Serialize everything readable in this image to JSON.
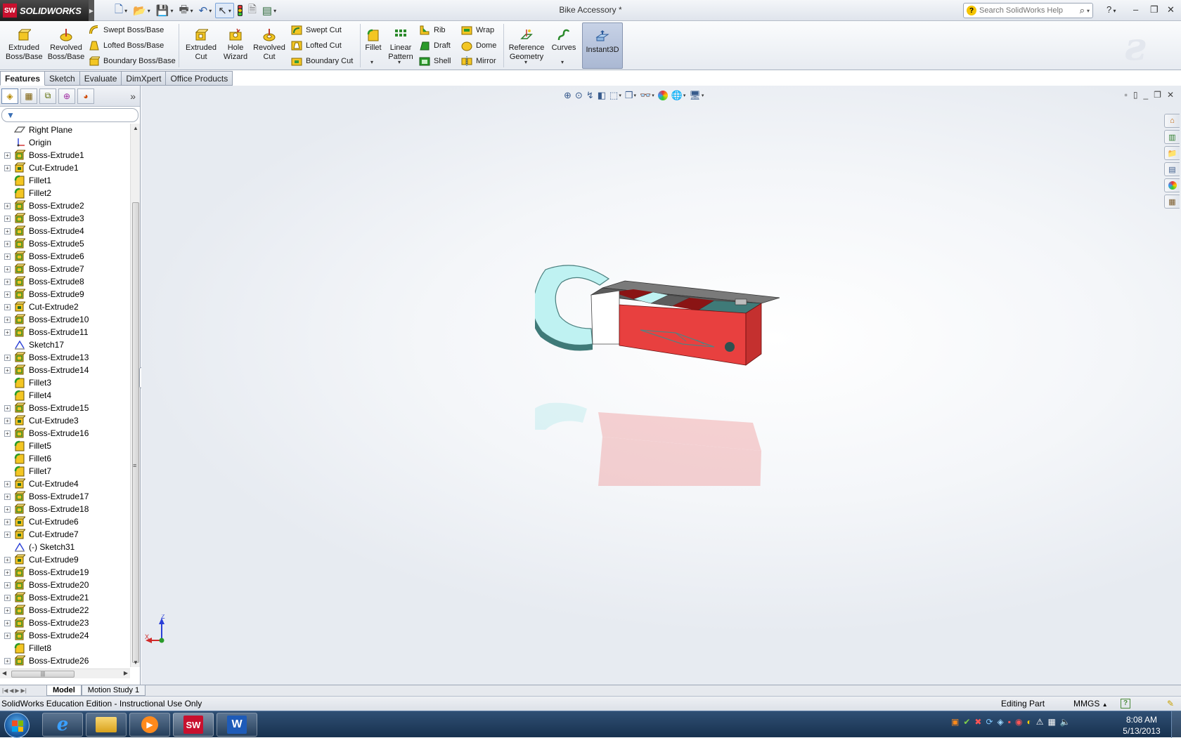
{
  "app": {
    "logo_text": "SOLIDWORKS",
    "document_title": "Bike Accessory *",
    "search_placeholder": "Search SolidWorks Help"
  },
  "command_manager": {
    "big_buttons": [
      {
        "label": "Extruded\nBoss/Base",
        "icon": "extruded-boss-icon"
      },
      {
        "label": "Revolved\nBoss/Base",
        "icon": "revolved-boss-icon"
      },
      {
        "label": "Extruded\nCut",
        "icon": "extruded-cut-icon"
      },
      {
        "label": "Hole\nWizard",
        "icon": "hole-wizard-icon"
      },
      {
        "label": "Revolved\nCut",
        "icon": "revolved-cut-icon"
      },
      {
        "label": "Fillet",
        "icon": "fillet-icon"
      },
      {
        "label": "Linear\nPattern",
        "icon": "linear-pattern-icon"
      },
      {
        "label": "Reference\nGeometry",
        "icon": "reference-geometry-icon"
      },
      {
        "label": "Curves",
        "icon": "curves-icon"
      }
    ],
    "small_buttons": {
      "swept_boss": "Swept Boss/Base",
      "lofted_boss": "Lofted Boss/Base",
      "boundary_boss": "Boundary Boss/Base",
      "swept_cut": "Swept Cut",
      "lofted_cut": "Lofted Cut",
      "boundary_cut": "Boundary Cut",
      "rib": "Rib",
      "draft": "Draft",
      "shell": "Shell",
      "wrap": "Wrap",
      "dome": "Dome",
      "mirror": "Mirror"
    },
    "instant3d": "Instant3D",
    "tabs": [
      "Features",
      "Sketch",
      "Evaluate",
      "DimXpert",
      "Office Products"
    ],
    "active_tab": "Features"
  },
  "feature_tree": [
    {
      "label": "Right Plane",
      "icon": "plane-icon",
      "expandable": false
    },
    {
      "label": "Origin",
      "icon": "origin-icon",
      "expandable": false
    },
    {
      "label": "Boss-Extrude1",
      "icon": "boss-extrude-icon",
      "expandable": true
    },
    {
      "label": "Cut-Extrude1",
      "icon": "cut-extrude-icon",
      "expandable": true
    },
    {
      "label": "Fillet1",
      "icon": "fillet-icon",
      "expandable": false
    },
    {
      "label": "Fillet2",
      "icon": "fillet-icon",
      "expandable": false
    },
    {
      "label": "Boss-Extrude2",
      "icon": "boss-extrude-icon",
      "expandable": true
    },
    {
      "label": "Boss-Extrude3",
      "icon": "boss-extrude-icon",
      "expandable": true
    },
    {
      "label": "Boss-Extrude4",
      "icon": "boss-extrude-icon",
      "expandable": true
    },
    {
      "label": "Boss-Extrude5",
      "icon": "boss-extrude-icon",
      "expandable": true
    },
    {
      "label": "Boss-Extrude6",
      "icon": "boss-extrude-icon",
      "expandable": true
    },
    {
      "label": "Boss-Extrude7",
      "icon": "boss-extrude-icon",
      "expandable": true
    },
    {
      "label": "Boss-Extrude8",
      "icon": "boss-extrude-icon",
      "expandable": true
    },
    {
      "label": "Boss-Extrude9",
      "icon": "boss-extrude-icon",
      "expandable": true
    },
    {
      "label": "Cut-Extrude2",
      "icon": "cut-extrude-icon",
      "expandable": true
    },
    {
      "label": "Boss-Extrude10",
      "icon": "boss-extrude-icon",
      "expandable": true
    },
    {
      "label": "Boss-Extrude11",
      "icon": "boss-extrude-icon",
      "expandable": true
    },
    {
      "label": "Sketch17",
      "icon": "sketch-icon",
      "expandable": false
    },
    {
      "label": "Boss-Extrude13",
      "icon": "boss-extrude-icon",
      "expandable": true
    },
    {
      "label": "Boss-Extrude14",
      "icon": "boss-extrude-icon",
      "expandable": true
    },
    {
      "label": "Fillet3",
      "icon": "fillet-icon",
      "expandable": false
    },
    {
      "label": "Fillet4",
      "icon": "fillet-icon",
      "expandable": false
    },
    {
      "label": "Boss-Extrude15",
      "icon": "boss-extrude-icon",
      "expandable": true
    },
    {
      "label": "Cut-Extrude3",
      "icon": "cut-extrude-icon",
      "expandable": true
    },
    {
      "label": "Boss-Extrude16",
      "icon": "boss-extrude-icon",
      "expandable": true
    },
    {
      "label": "Fillet5",
      "icon": "fillet-icon",
      "expandable": false
    },
    {
      "label": "Fillet6",
      "icon": "fillet-icon",
      "expandable": false
    },
    {
      "label": "Fillet7",
      "icon": "fillet-icon",
      "expandable": false
    },
    {
      "label": "Cut-Extrude4",
      "icon": "cut-extrude-icon",
      "expandable": true
    },
    {
      "label": "Boss-Extrude17",
      "icon": "boss-extrude-icon",
      "expandable": true
    },
    {
      "label": "Boss-Extrude18",
      "icon": "boss-extrude-icon",
      "expandable": true
    },
    {
      "label": "Cut-Extrude6",
      "icon": "cut-extrude-icon",
      "expandable": true
    },
    {
      "label": "Cut-Extrude7",
      "icon": "cut-extrude-icon",
      "expandable": true
    },
    {
      "label": "(-) Sketch31",
      "icon": "sketch-icon",
      "expandable": false
    },
    {
      "label": "Cut-Extrude9",
      "icon": "cut-extrude-icon",
      "expandable": true
    },
    {
      "label": "Boss-Extrude19",
      "icon": "boss-extrude-icon",
      "expandable": true
    },
    {
      "label": "Boss-Extrude20",
      "icon": "boss-extrude-icon",
      "expandable": true
    },
    {
      "label": "Boss-Extrude21",
      "icon": "boss-extrude-icon",
      "expandable": true
    },
    {
      "label": "Boss-Extrude22",
      "icon": "boss-extrude-icon",
      "expandable": true
    },
    {
      "label": "Boss-Extrude23",
      "icon": "boss-extrude-icon",
      "expandable": true
    },
    {
      "label": "Boss-Extrude24",
      "icon": "boss-extrude-icon",
      "expandable": true
    },
    {
      "label": "Fillet8",
      "icon": "fillet-icon",
      "expandable": false
    },
    {
      "label": "Boss-Extrude26",
      "icon": "boss-extrude-icon",
      "expandable": true
    }
  ],
  "triad": {
    "z": "Z",
    "x": "X"
  },
  "bottom_tabs": [
    "Model",
    "Motion Study 1"
  ],
  "status": {
    "left": "SolidWorks Education Edition - Instructional Use Only",
    "mode": "Editing Part",
    "units": "MMGS",
    "units_arrow": "▲",
    "help": "?"
  },
  "taskbar": {
    "time": "8:08 AM",
    "date": "5/13/2013"
  },
  "colors": {
    "model_red": "#e8403f",
    "model_cyan": "#bff2f2",
    "model_teal": "#3f7a78",
    "model_darkred": "#8a1414",
    "model_gray": "#5c5c5c"
  }
}
